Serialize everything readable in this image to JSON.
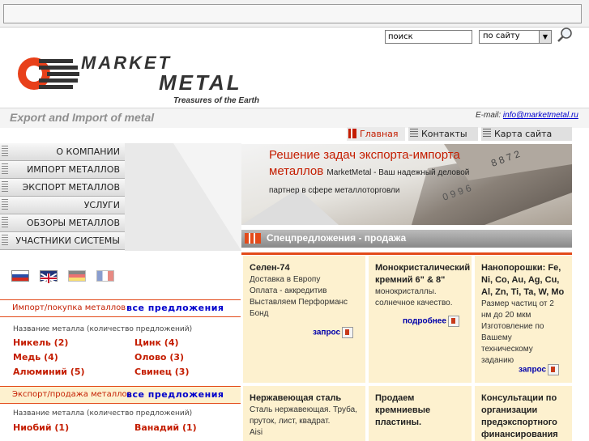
{
  "header": {
    "search": {
      "placeholder": "поиск",
      "scope": "по сайту"
    },
    "logo": {
      "line1": "MARKET",
      "line2": "METAL",
      "tagline": "Treasures of the Earth"
    },
    "slogan": "Export and Import of metal",
    "email_label": "E-mail:",
    "email": "info@marketmetal.ru"
  },
  "tabs": [
    {
      "label": "Главная",
      "color": "#c41d00"
    },
    {
      "label": "Контакты"
    },
    {
      "label": "Карта сайта"
    }
  ],
  "nav": [
    {
      "label": "О КОМПАНИИ"
    },
    {
      "label": "ИМПОРТ МЕТАЛЛОВ"
    },
    {
      "label": "ЭКСПОРТ МЕТАЛЛОВ"
    },
    {
      "label": "УСЛУГИ"
    },
    {
      "label": "ОБЗОРЫ МЕТАЛЛОВ"
    },
    {
      "label": "УЧАСТНИКИ СИСТЕМЫ"
    }
  ],
  "languages": [
    "ru",
    "en",
    "de",
    "fr"
  ],
  "hero": {
    "title_line1": "Решение задач экспорта-импорта",
    "title_line2": "металлов",
    "subtitle": "MarketMetal - Ваш надежный деловой партнер в сфере металлоторговли"
  },
  "special": {
    "title": "Спецпредложения - продажа",
    "offers": [
      {
        "title": "Селен-74",
        "lines": [
          "Доставка в Европу",
          "Оплата - аккредитив",
          "Выставляем Перформанс Бонд"
        ],
        "action": "запрос"
      },
      {
        "title": "Монокристалический кремний 6\" & 8\"",
        "lines": [
          "монокристаллы. солнечное качество."
        ],
        "action": "подробнее"
      },
      {
        "title": "Нанопорошки: Fe, Ni, Co, Au, Ag, Cu, Al, Zn, Ti, Ta, W, Mo",
        "lines": [
          "Размер частиц от 2 нм до 20 мкм",
          "Изготовление по Вашему техническому заданию"
        ],
        "action": "запрос"
      },
      {
        "title": "Нержавеющая сталь",
        "lines": [
          "Сталь нержавеющая. Труба, пруток, лист, квадрат.",
          "Aisi"
        ],
        "action": ""
      },
      {
        "title": "Продаем кремниевые пластины.",
        "lines": [],
        "action": ""
      },
      {
        "title": "Консультации по организации предэкспортного финансирования",
        "lines": [],
        "action": ""
      }
    ]
  },
  "import_box": {
    "title": "Импорт/покупка металлов",
    "all": "все предложения",
    "caption": "Название металла (количество предложений)",
    "items": [
      "Никель (2)",
      "Цинк (4)",
      "Медь (4)",
      "Олово (3)",
      "Алюминий (5)",
      "Свинец (3)"
    ]
  },
  "export_box": {
    "title": "Экспорт/продажа металлов",
    "all": "все предложения",
    "caption": "Название металла (количество предложений)",
    "items": [
      "Ниобий (1)",
      "Ванадий (1)"
    ]
  }
}
